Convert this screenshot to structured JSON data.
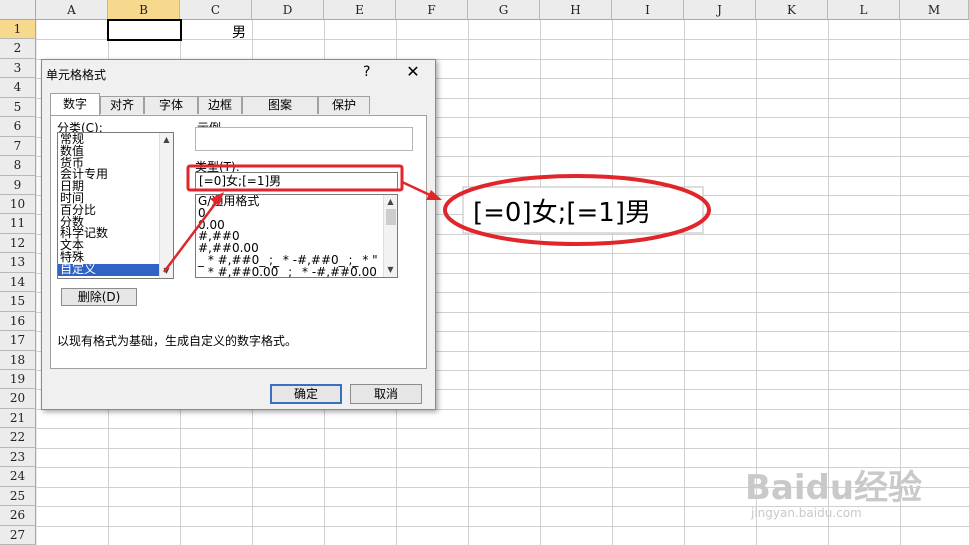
{
  "sheet": {
    "columns": [
      "A",
      "B",
      "C",
      "D",
      "E",
      "F",
      "G",
      "H",
      "I",
      "J",
      "K",
      "L",
      "M"
    ],
    "rows": [
      "1",
      "2",
      "3",
      "4",
      "5",
      "6",
      "7",
      "8",
      "9",
      "10",
      "11",
      "12",
      "13",
      "14",
      "15",
      "16",
      "17",
      "18",
      "19",
      "20",
      "21",
      "22",
      "23",
      "24",
      "25",
      "26",
      "27"
    ],
    "c1_value": "男"
  },
  "dialog": {
    "title": "单元格格式",
    "help": "?",
    "close": "✕",
    "tabs": [
      "数字",
      "对齐",
      "字体",
      "边框",
      "图案",
      "保护"
    ],
    "category_label": "分类(C):",
    "categories": [
      "常规",
      "数值",
      "货币",
      "会计专用",
      "日期",
      "时间",
      "百分比",
      "分数",
      "科学记数",
      "文本",
      "特殊",
      "自定义"
    ],
    "sample_label": "示例",
    "type_label": "类型(T):",
    "type_value": "[=0]女;[=1]男",
    "formats": [
      "G/通用格式",
      "0",
      "0.00",
      "#,##0",
      "#,##0.00",
      "_ * #,##0_ ;_ * -#,##0_ ;_ * \"",
      "_ * #,##0.00_ ;_ * -#,##0.00_"
    ],
    "delete_button": "删除(D)",
    "description": "以现有格式为基础，生成自定义的数字格式。",
    "ok_button": "确定",
    "cancel_button": "取消"
  },
  "zoom_text": "[=0]女;[=1]男",
  "watermark": {
    "text": "Baidu经验",
    "sub": "jingyan.baidu.com"
  }
}
